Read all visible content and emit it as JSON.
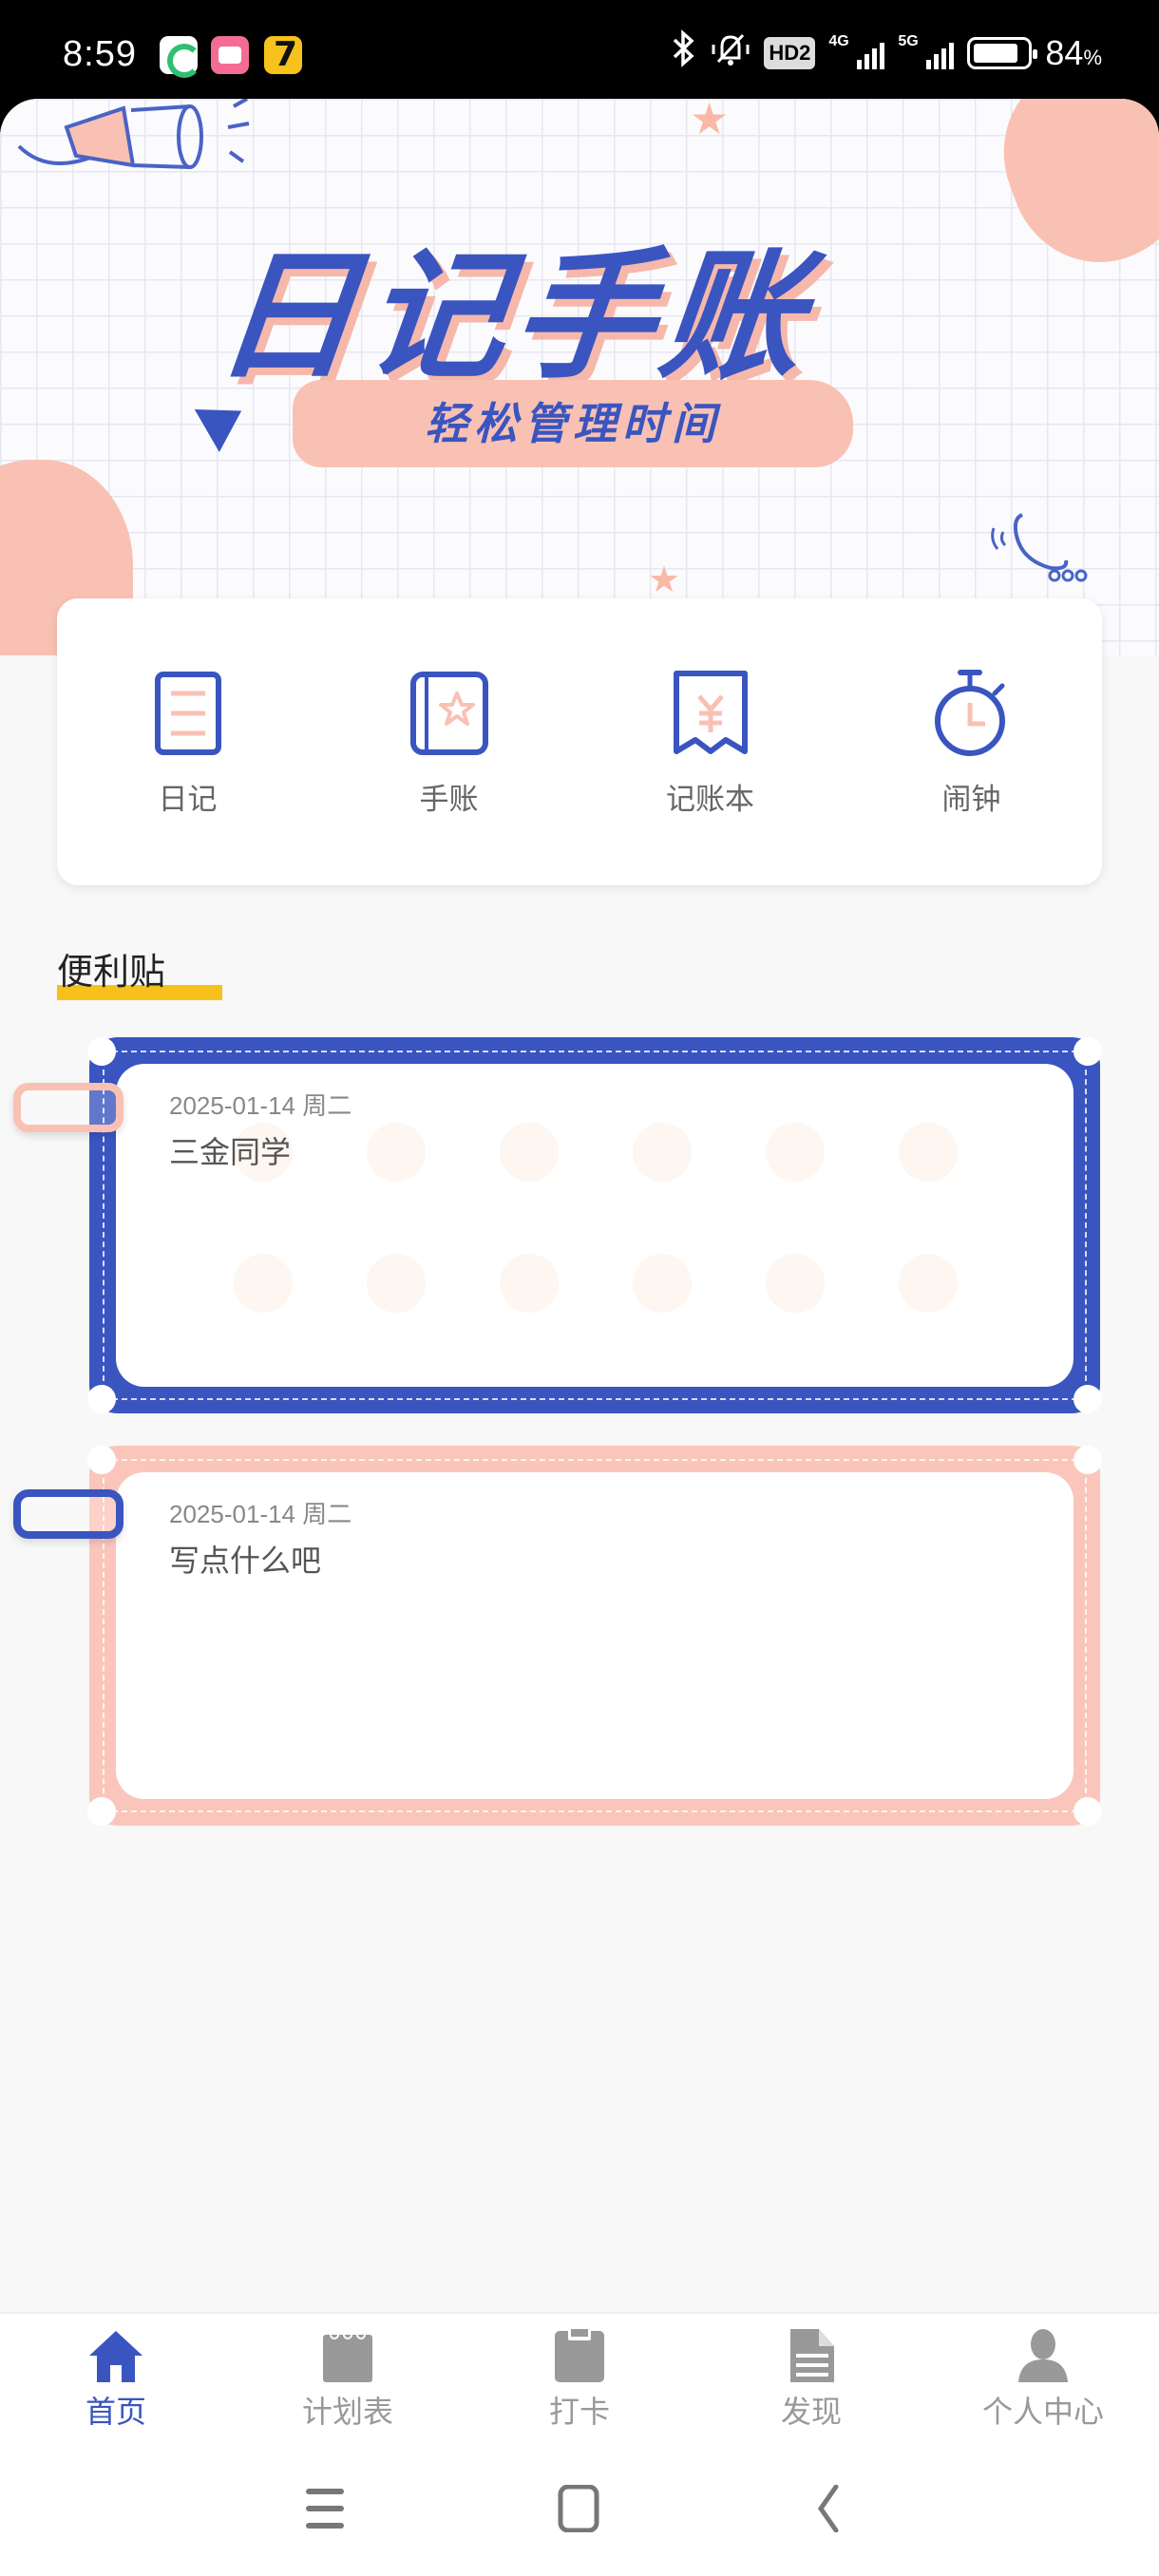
{
  "status_bar": {
    "time": "8:59",
    "apps": [
      "app-icon-green",
      "app-icon-bilibili",
      "app-icon-qimao"
    ],
    "network_1": "4G",
    "network_2": "5G",
    "hd_badge": "HD2",
    "battery_percent": "84",
    "battery_unit": "%"
  },
  "banner": {
    "title": "日记手账",
    "subtitle": "轻松管理时间"
  },
  "quick_actions": [
    {
      "label": "日记",
      "icon": "diary-icon"
    },
    {
      "label": "手账",
      "icon": "journal-icon"
    },
    {
      "label": "记账本",
      "icon": "ledger-icon"
    },
    {
      "label": "闹钟",
      "icon": "alarm-icon"
    }
  ],
  "section": {
    "title": "便利贴"
  },
  "notes": [
    {
      "date": "2025-01-14 周二",
      "text": "三金同学",
      "frame_color": "#3a55c0",
      "tab_color": "#f9c1b3"
    },
    {
      "date": "2025-01-14 周二",
      "text": "写点什么吧",
      "frame_color": "#fac6bb",
      "tab_color": "#3a55c0"
    }
  ],
  "bottom_nav": {
    "active_index": 0,
    "items": [
      {
        "label": "首页",
        "icon": "home-icon"
      },
      {
        "label": "计划表",
        "icon": "notepad-icon"
      },
      {
        "label": "打卡",
        "icon": "clipboard-icon"
      },
      {
        "label": "发现",
        "icon": "document-icon"
      },
      {
        "label": "个人中心",
        "icon": "user-icon"
      }
    ]
  },
  "colors": {
    "primary": "#3a55c0",
    "accent_pink": "#f9c1b3",
    "highlight_yellow": "#f6c11a",
    "inactive_gray": "#999999"
  }
}
